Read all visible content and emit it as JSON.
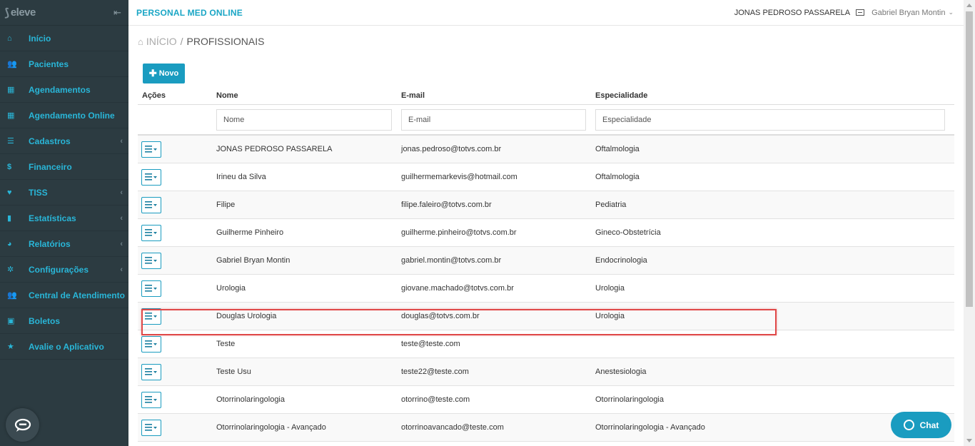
{
  "sidebar": {
    "logo_text": "eleve",
    "items": [
      {
        "label": "Início",
        "icon": "home-icon",
        "glyph": "⌂",
        "has_sub": false
      },
      {
        "label": "Pacientes",
        "icon": "users-icon",
        "glyph": "👥",
        "has_sub": false
      },
      {
        "label": "Agendamentos",
        "icon": "calendar-icon",
        "glyph": "▦",
        "has_sub": false
      },
      {
        "label": "Agendamento Online",
        "icon": "calendar-icon",
        "glyph": "▦",
        "has_sub": false
      },
      {
        "label": "Cadastros",
        "icon": "list-icon",
        "glyph": "☰",
        "has_sub": true
      },
      {
        "label": "Financeiro",
        "icon": "dollar-icon",
        "glyph": "$",
        "has_sub": false
      },
      {
        "label": "TISS",
        "icon": "heartbeat-icon",
        "glyph": "♥",
        "has_sub": true
      },
      {
        "label": "Estatísticas",
        "icon": "bar-chart-icon",
        "glyph": "▮",
        "has_sub": true
      },
      {
        "label": "Relatórios",
        "icon": "pie-chart-icon",
        "glyph": "◕",
        "has_sub": true
      },
      {
        "label": "Configurações",
        "icon": "gear-icon",
        "glyph": "✲",
        "has_sub": true
      },
      {
        "label": "Central de Atendimento",
        "icon": "users-icon",
        "glyph": "👥",
        "has_sub": false
      },
      {
        "label": "Boletos",
        "icon": "money-icon",
        "glyph": "▣",
        "has_sub": false
      },
      {
        "label": "Avalie o Aplicativo",
        "icon": "star-icon",
        "glyph": "★",
        "has_sub": false
      }
    ]
  },
  "header": {
    "brand": "PERSONAL MED ONLINE",
    "clinic": "JONAS PEDROSO PASSARELA",
    "user": "Gabriel Bryan Montin"
  },
  "breadcrumb": {
    "home": "INÍCIO",
    "separator": "/",
    "current": "PROFISSIONAIS"
  },
  "toolbar": {
    "new_label": "Novo"
  },
  "table": {
    "headers": {
      "actions": "Ações",
      "name": "Nome",
      "email": "E-mail",
      "specialty": "Especialidade"
    },
    "filters": {
      "name": "Nome",
      "email": "E-mail",
      "specialty": "Especialidade"
    },
    "rows": [
      {
        "name": "JONAS PEDROSO PASSARELA",
        "email": "jonas.pedroso@totvs.com.br",
        "specialty": "Oftalmologia"
      },
      {
        "name": "Irineu da Silva",
        "email": "guilhermemarkevis@hotmail.com",
        "specialty": "Oftalmologia"
      },
      {
        "name": "Filipe",
        "email": "filipe.faleiro@totvs.com.br",
        "specialty": "Pediatria"
      },
      {
        "name": "Guilherme Pinheiro",
        "email": "guilherme.pinheiro@totvs.com.br",
        "specialty": "Gineco-Obstetrícia"
      },
      {
        "name": "Gabriel Bryan Montin",
        "email": "gabriel.montin@totvs.com.br",
        "specialty": "Endocrinologia"
      },
      {
        "name": "Urologia",
        "email": "giovane.machado@totvs.com.br",
        "specialty": "Urologia"
      },
      {
        "name": "Douglas Urologia",
        "email": "douglas@totvs.com.br",
        "specialty": "Urologia"
      },
      {
        "name": "Teste",
        "email": "teste@teste.com",
        "specialty": ""
      },
      {
        "name": "Teste Usu",
        "email": "teste22@teste.com",
        "specialty": "Anestesiologia"
      },
      {
        "name": "Otorrinolaringologia",
        "email": "otorrino@teste.com",
        "specialty": "Otorrinolaringologia"
      },
      {
        "name": "Otorrinolaringologia - Avançado",
        "email": "otorrinoavancado@teste.com",
        "specialty": "Otorrinolaringologia - Avançado"
      }
    ]
  },
  "chat": {
    "label": "Chat"
  },
  "colors": {
    "sidebar_bg": "#2c3b41",
    "accent": "#1a9cc0",
    "highlight": "#e04848"
  }
}
